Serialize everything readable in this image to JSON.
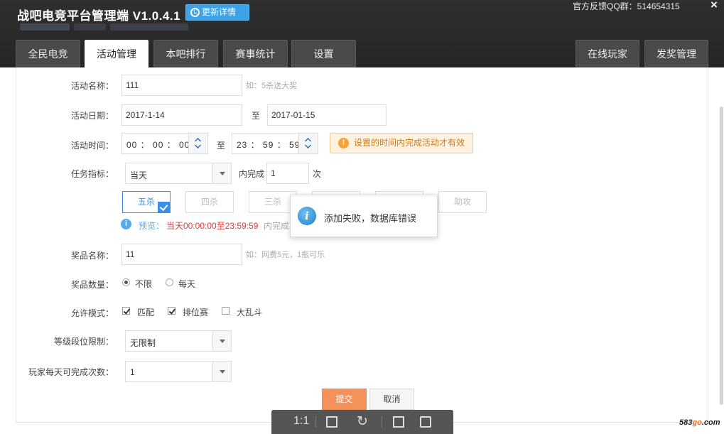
{
  "header": {
    "app_title": "战吧电竞平台管理端",
    "version": "V1.0.4.1",
    "update_button": "更新详情",
    "feedback": "官方反馈QQ群：514654315",
    "close": "×"
  },
  "tabs_left": [
    {
      "label": "全民电竞"
    },
    {
      "label": "活动管理"
    },
    {
      "label": "本吧排行"
    },
    {
      "label": "赛事统计"
    },
    {
      "label": "设置"
    }
  ],
  "tabs_right": [
    {
      "label": "在线玩家"
    },
    {
      "label": "发奖管理"
    }
  ],
  "form": {
    "activity_name": {
      "label": "活动名称：",
      "value": "111",
      "hint": "如：5杀送大奖"
    },
    "activity_date": {
      "label": "活动日期：",
      "start": "2017-1-14",
      "separator": "至",
      "end": "2017-01-15"
    },
    "activity_time": {
      "label": "活动时间：",
      "start": "00 ： 00 ： 00",
      "separator": "至",
      "end": "23 ： 59 ： 59",
      "warning": "设置的时间内完成活动才有效"
    },
    "task": {
      "label": "任务指标：",
      "period": "当天",
      "complete_label": "内完成",
      "count": "1",
      "unit": "次"
    },
    "kill_options": [
      {
        "label": "五杀"
      },
      {
        "label": "四杀"
      },
      {
        "label": "三杀"
      },
      {
        "label": "助攻"
      }
    ],
    "preview": {
      "label": "预览：",
      "highlight": "当天00:00:00至23:59:59",
      "rest": "内完成"
    },
    "prize_name": {
      "label": "奖品名称：",
      "value": "11",
      "hint": "如：网费5元，1瓶可乐"
    },
    "prize_quantity": {
      "label": "奖品数量：",
      "option_unlimited": "不限",
      "option_daily": "每天"
    },
    "allowed_modes": {
      "label": "允许模式：",
      "mode1": "匹配",
      "mode2": "排位赛",
      "mode3": "大乱斗"
    },
    "rank_limit": {
      "label": "等级段位限制：",
      "value": "无限制"
    },
    "daily_completions": {
      "label": "玩家每天可完成次数：",
      "value": "1"
    },
    "submit": "提交",
    "cancel": "取消"
  },
  "popup": {
    "icon": "i",
    "message": "添加失败，数据库错误"
  },
  "viewer_toolbar": {
    "one_to_one": "1:1"
  },
  "watermark": {
    "prefix": "583",
    "highlight": "go",
    "suffix": ".com"
  },
  "colors": {
    "accent_blue": "#3a8ee6",
    "submit_orange": "#f5925b",
    "warning_orange": "#f2a33a",
    "preview_red": "#e03a3a"
  }
}
